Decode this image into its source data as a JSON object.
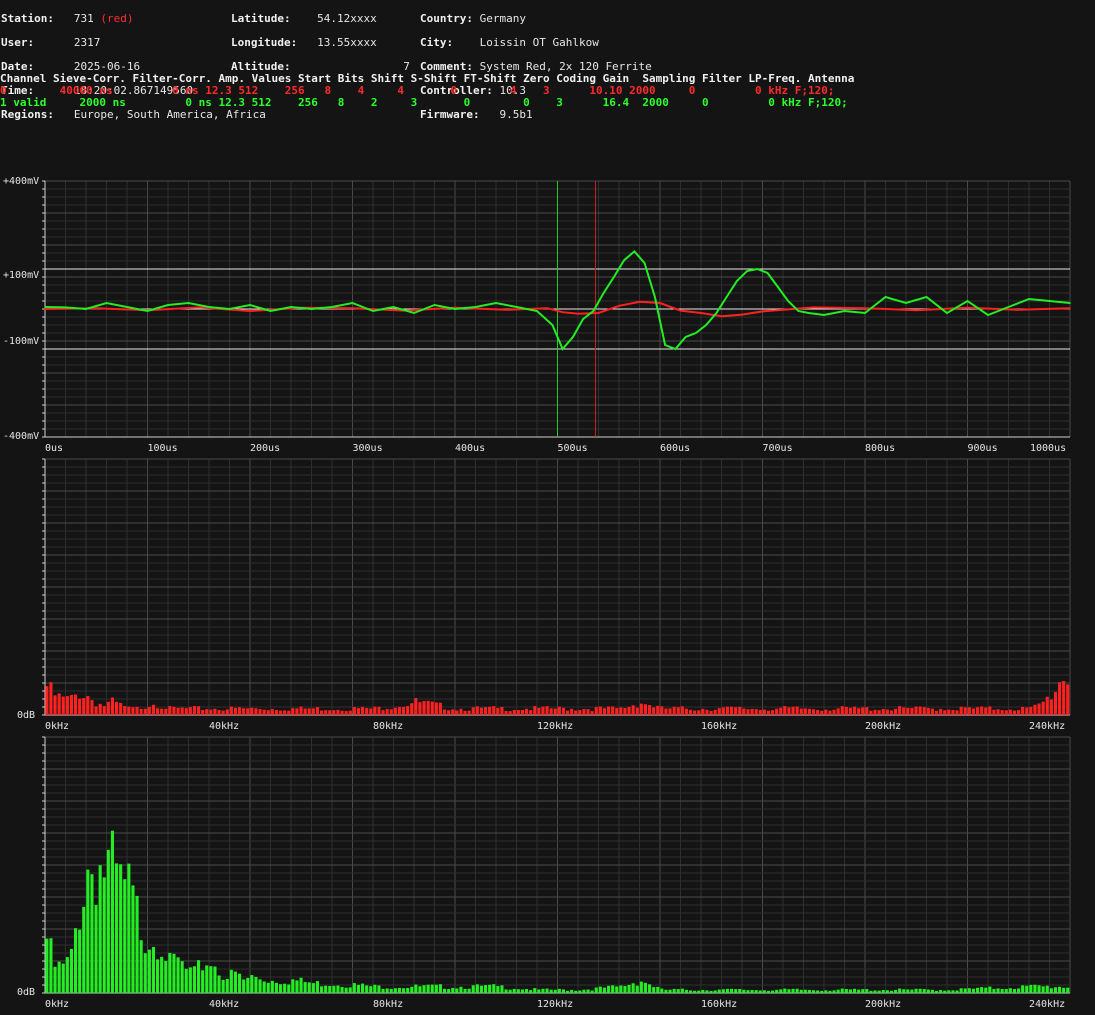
{
  "station": {
    "station_label": "Station:",
    "station_value": "731",
    "station_color_tag": "(red)",
    "user_label": "User:",
    "user_value": "2317",
    "date_label": "Date:",
    "date_value": "2025-06-16",
    "time_label": "Time:",
    "time_value": "18:20:02.867149560",
    "regions_label": "Regions:",
    "regions_value": "Europe, South America, Africa",
    "latitude_label": "Latitude:",
    "latitude_value": "54.12xxxx",
    "longitude_label": "Longitude:",
    "longitude_value": "13.55xxxx",
    "altitude_label": "Altitude:",
    "altitude_value": "7",
    "country_label": "Country:",
    "country_value": "Germany",
    "city_label": "City:",
    "city_value": "Loissin OT Gahlkow",
    "comment_label": "Comment:",
    "comment_value": "System Red, 2x 120 Ferrite",
    "controller_label": "Controller:",
    "controller_value": "10.3",
    "firmware_label": "Firmware:",
    "firmware_value": "9.5b1"
  },
  "channel_table": {
    "header": "Channel Sieve-Corr. Filter-Corr. Amp. Values Start Bits Shift S-Shift FT-Shift Zero Coding Gain  Sampling Filter LP-Freq. Antenna",
    "rows": [
      "0        40000 ns         0 ns 12.3 512    256   8    4     4       0        4    3      10.10 2000     0         0 kHz F;120;",
      "1 valid     2000 ns         0 ns 12.3 512    256   8    2     3       0        0    3      16.4  2000     0         0 kHz F;120;"
    ]
  },
  "waveform_chart": {
    "y_labels": [
      "+400mV",
      "+100mV",
      "-100mV",
      "-400mV"
    ],
    "x_labels": [
      "0us",
      "100us",
      "200us",
      "300us",
      "400us",
      "500us",
      "600us",
      "700us",
      "800us",
      "900us",
      "1000us"
    ]
  },
  "spectrum_red": {
    "y_label": "0dB",
    "x_labels": [
      "0kHz",
      "40kHz",
      "80kHz",
      "120kHz",
      "160kHz",
      "200kHz",
      "240kHz"
    ]
  },
  "spectrum_green": {
    "y_label": "0dB",
    "x_labels": [
      "0kHz",
      "40kHz",
      "80kHz",
      "120kHz",
      "160kHz",
      "200kHz",
      "240kHz"
    ]
  },
  "colors": {
    "background": "#141414",
    "channel0": "#ff2020",
    "channel1": "#22ee22",
    "grid": "#3a3a3a"
  },
  "chart_data": [
    {
      "type": "line",
      "xlabel": "",
      "ylabel": "",
      "xlim": [
        0,
        1000
      ],
      "ylim": [
        -400,
        400
      ],
      "x_unit": "us",
      "y_unit": "mV",
      "series": [
        {
          "name": "0",
          "color": "#ff2020",
          "x": [
            0,
            50,
            100,
            150,
            200,
            250,
            300,
            350,
            400,
            450,
            490,
            505,
            520,
            540,
            560,
            580,
            600,
            620,
            640,
            660,
            680,
            700,
            750,
            800,
            850,
            900,
            950,
            1000
          ],
          "y": [
            0,
            2,
            -3,
            4,
            -5,
            3,
            2,
            -4,
            3,
            -2,
            2,
            -8,
            -12,
            -10,
            8,
            18,
            15,
            -4,
            -10,
            -18,
            -14,
            -6,
            4,
            2,
            -3,
            3,
            -2,
            2
          ]
        },
        {
          "name": "1 valid",
          "color": "#22ee22",
          "x": [
            0,
            20,
            40,
            60,
            80,
            100,
            120,
            140,
            160,
            180,
            200,
            220,
            240,
            260,
            280,
            300,
            320,
            340,
            360,
            380,
            400,
            420,
            440,
            460,
            480,
            495,
            505,
            515,
            525,
            535,
            545,
            555,
            565,
            575,
            585,
            595,
            605,
            615,
            625,
            635,
            645,
            655,
            665,
            675,
            685,
            695,
            705,
            715,
            725,
            735,
            745,
            760,
            780,
            800,
            820,
            840,
            860,
            880,
            900,
            920,
            940,
            960,
            980,
            1000
          ],
          "y": [
            5,
            4,
            0,
            15,
            5,
            -5,
            10,
            15,
            5,
            0,
            10,
            -5,
            5,
            0,
            5,
            15,
            -5,
            5,
            -10,
            10,
            0,
            5,
            15,
            5,
            -5,
            -40,
            -100,
            -70,
            -25,
            -5,
            40,
            80,
            130,
            160,
            120,
            30,
            -90,
            -100,
            -70,
            -60,
            -40,
            -10,
            30,
            70,
            95,
            100,
            90,
            55,
            20,
            -5,
            -10,
            -15,
            -5,
            -10,
            30,
            15,
            30,
            -10,
            20,
            -15,
            5,
            25,
            20,
            15
          ]
        }
      ]
    },
    {
      "type": "bar",
      "x_unit": "kHz",
      "xlim": [
        0,
        250
      ],
      "series": [
        {
          "name": "0",
          "color": "#ff2020",
          "x": [
            0,
            2,
            4,
            6,
            8,
            10,
            12,
            14,
            16,
            18,
            20,
            22,
            24,
            26,
            28,
            30,
            40,
            60,
            80,
            90,
            100,
            110,
            120,
            130,
            140,
            145,
            150,
            160,
            180,
            200,
            220,
            230,
            240,
            242,
            244,
            246,
            248,
            250
          ],
          "y": [
            0.09,
            0.06,
            0.05,
            0.05,
            0.07,
            0.06,
            0.04,
            0.03,
            0.04,
            0.03,
            0.02,
            0.02,
            0.03,
            0.04,
            0.03,
            0.02,
            0.02,
            0.02,
            0.02,
            0.04,
            0.02,
            0.02,
            0.02,
            0.02,
            0.02,
            0.04,
            0.02,
            0.02,
            0.02,
            0.02,
            0.02,
            0.02,
            0.02,
            0.03,
            0.05,
            0.08,
            0.13,
            0.1
          ]
        }
      ]
    },
    {
      "type": "bar",
      "x_unit": "kHz",
      "xlim": [
        0,
        250
      ],
      "series": [
        {
          "name": "1 valid",
          "color": "#22ee22",
          "x": [
            0,
            2,
            4,
            6,
            8,
            10,
            12,
            14,
            16,
            18,
            20,
            22,
            24,
            26,
            28,
            30,
            32,
            34,
            36,
            38,
            40,
            42,
            44,
            46,
            48,
            50,
            55,
            60,
            65,
            70,
            80,
            90,
            100,
            110,
            120,
            130,
            140,
            145,
            150,
            160,
            180,
            200,
            220,
            240,
            250
          ],
          "y": [
            0.17,
            0.08,
            0.08,
            0.11,
            0.27,
            0.39,
            0.41,
            0.39,
            0.37,
            0.32,
            0.31,
            0.24,
            0.19,
            0.18,
            0.17,
            0.09,
            0.1,
            0.07,
            0.06,
            0.09,
            0.1,
            0.07,
            0.05,
            0.06,
            0.04,
            0.05,
            0.04,
            0.04,
            0.03,
            0.03,
            0.02,
            0.02,
            0.02,
            0.02,
            0.01,
            0.01,
            0.02,
            0.04,
            0.01,
            0.01,
            0.01,
            0.01,
            0.01,
            0.02,
            0.02
          ]
        }
      ]
    }
  ]
}
